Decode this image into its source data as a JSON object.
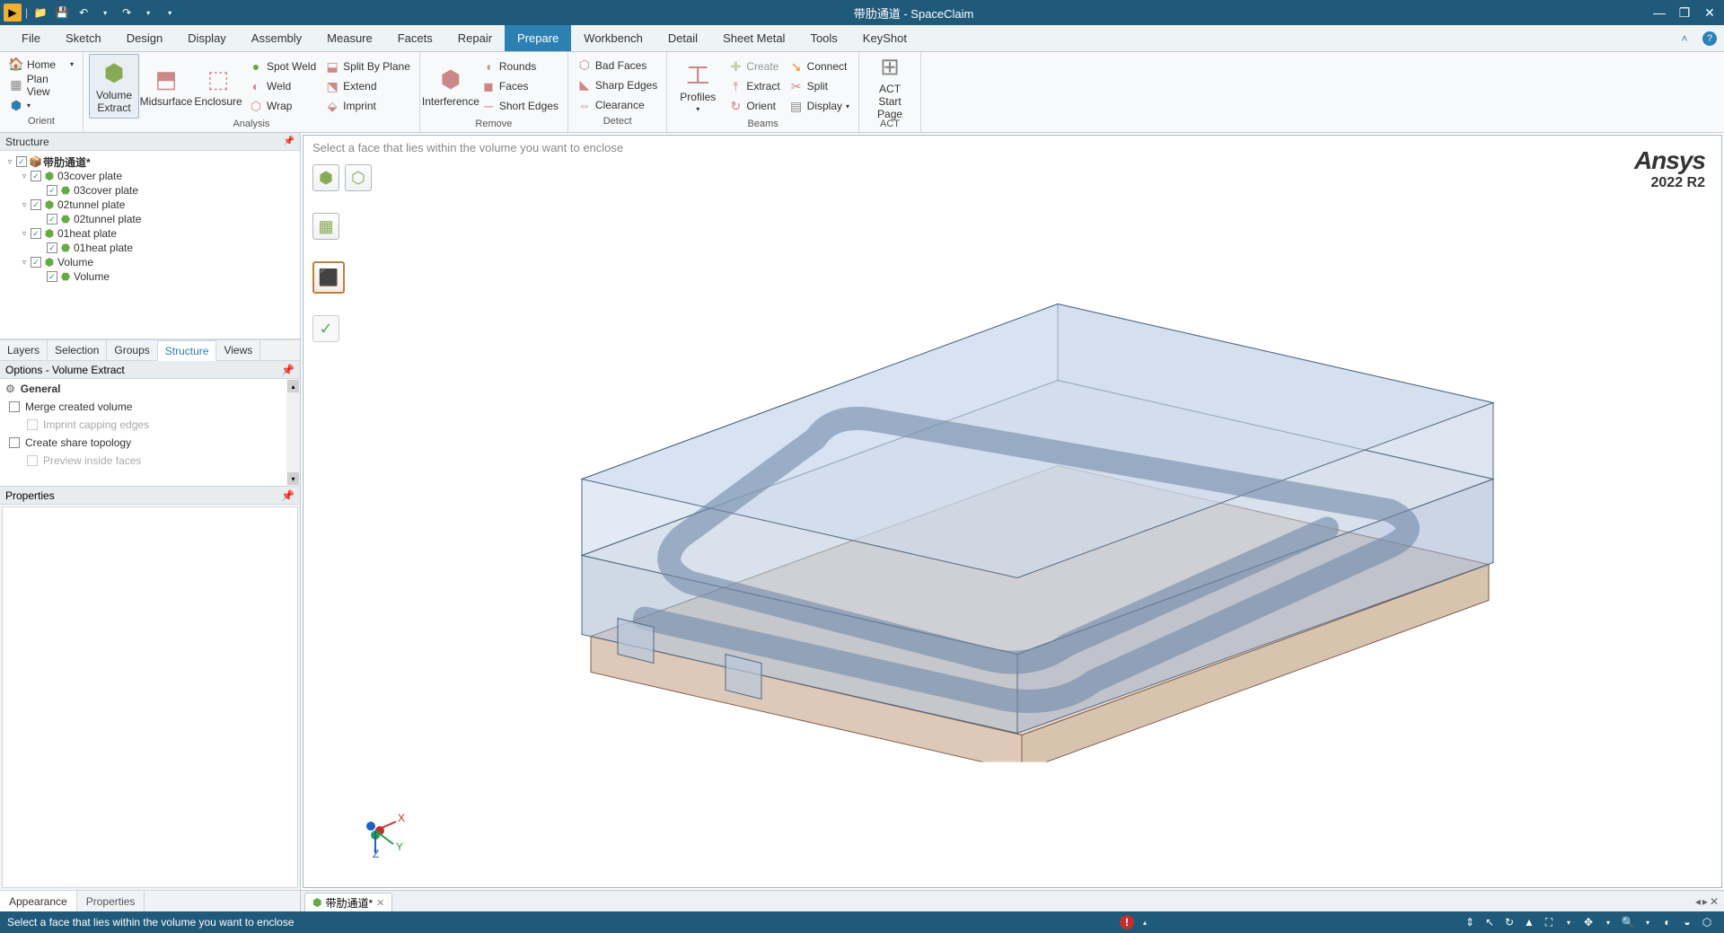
{
  "titlebar": {
    "app_title": "带肋通道 - SpaceClaim"
  },
  "menu": {
    "items": [
      "File",
      "Sketch",
      "Design",
      "Display",
      "Assembly",
      "Measure",
      "Facets",
      "Repair",
      "Prepare",
      "Workbench",
      "Detail",
      "Sheet Metal",
      "Tools",
      "KeyShot"
    ],
    "active": "Prepare"
  },
  "ribbon": {
    "orient_group_label": "Orient",
    "home_label": "Home",
    "planview_label": "Plan View",
    "volume_extract_label": "Volume\nExtract",
    "midsurface_label": "Midsurface",
    "enclosure_label": "Enclosure",
    "spotweld_label": "Spot Weld",
    "splitbyplane_label": "Split By Plane",
    "weld_label": "Weld",
    "extend_label": "Extend",
    "wrap_label": "Wrap",
    "imprint_label": "Imprint",
    "analysis_group_label": "Analysis",
    "interference_label": "Interference",
    "rounds_label": "Rounds",
    "faces_label": "Faces",
    "shortedges_label": "Short Edges",
    "remove_group_label": "Remove",
    "badfaces_label": "Bad Faces",
    "sharpedges_label": "Sharp Edges",
    "clearance_label": "Clearance",
    "detect_group_label": "Detect",
    "profiles_label": "Profiles",
    "create_label": "Create",
    "extract_label": "Extract",
    "orient_beam_label": "Orient",
    "connect_label": "Connect",
    "split_label": "Split",
    "display_label": "Display",
    "beams_group_label": "Beams",
    "act_start_label": "ACT Start\nPage",
    "act_group_label": "ACT"
  },
  "structure_panel": {
    "header": "Structure",
    "root_name": "带肋通道*",
    "nodes": [
      {
        "level": 1,
        "name": "03cover plate",
        "icon": "asm"
      },
      {
        "level": 2,
        "name": "03cover plate",
        "icon": "part"
      },
      {
        "level": 1,
        "name": "02tunnel plate",
        "icon": "asm"
      },
      {
        "level": 2,
        "name": "02tunnel plate",
        "icon": "part"
      },
      {
        "level": 1,
        "name": "01heat plate",
        "icon": "asm"
      },
      {
        "level": 2,
        "name": "01heat plate",
        "icon": "part"
      },
      {
        "level": 1,
        "name": "Volume",
        "icon": "asm"
      },
      {
        "level": 2,
        "name": "Volume",
        "icon": "part"
      }
    ],
    "tabs": [
      "Layers",
      "Selection",
      "Groups",
      "Structure",
      "Views"
    ],
    "active_tab": "Structure"
  },
  "options_panel": {
    "header": "Options - Volume Extract",
    "general_label": "General",
    "merge_label": "Merge created volume",
    "imprint_cap_label": "Imprint capping edges",
    "share_topo_label": "Create share topology",
    "preview_label": "Preview inside faces"
  },
  "properties_panel": {
    "header": "Properties"
  },
  "bottom_tabs": {
    "tabs": [
      "Appearance",
      "Properties"
    ],
    "active": "Appearance"
  },
  "viewport": {
    "prompt": "Select a face that lies within the volume you want to enclose",
    "logo_text": "Ansys",
    "logo_version": "2022 R2",
    "triad": {
      "x": "X",
      "y": "Y",
      "z": "Z"
    }
  },
  "doc_tabs": {
    "current": "带肋通道*"
  },
  "statusbar": {
    "message": "Select a face that lies within the volume you want to enclose"
  }
}
